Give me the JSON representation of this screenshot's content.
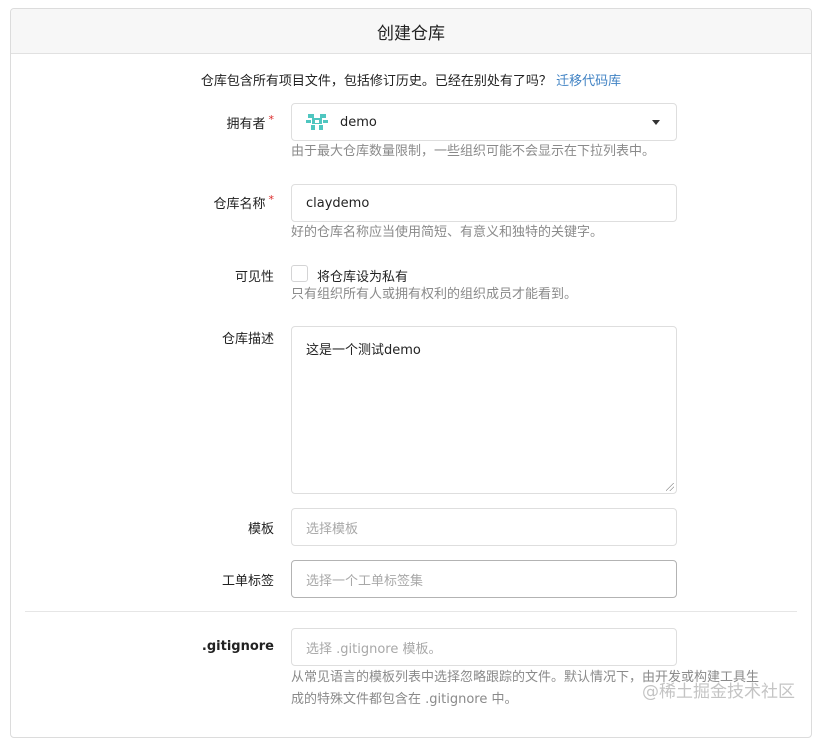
{
  "header": {
    "title": "创建仓库"
  },
  "intro": {
    "text": "仓库包含所有项目文件，包括修订历史。已经在别处有了吗？",
    "link": "迁移代码库"
  },
  "owner": {
    "label": "拥有者",
    "required_mark": "*",
    "value": "demo",
    "help": "由于最大仓库数量限制，一些组织可能不会显示在下拉列表中。"
  },
  "repo_name": {
    "label": "仓库名称",
    "required_mark": "*",
    "value": "claydemo",
    "help": "好的仓库名称应当使用简短、有意义和独特的关键字。"
  },
  "visibility": {
    "label": "可见性",
    "checkbox_label": "将仓库设为私有",
    "help": "只有组织所有人或拥有权利的组织成员才能看到。"
  },
  "description": {
    "label": "仓库描述",
    "value": "这是一个测试demo"
  },
  "template": {
    "label": "模板",
    "placeholder": "选择模板"
  },
  "issue_labels": {
    "label": "工单标签",
    "placeholder": "选择一个工单标签集"
  },
  "gitignore": {
    "label": ".gitignore",
    "placeholder": "选择 .gitignore 模板。",
    "help_line1": "从常见语言的模板列表中选择忽略跟踪的文件。默认情况下，由开发或构建工具生",
    "help_line2": "成的特殊文件都包含在 .gitignore 中。"
  },
  "watermark": "@稀土掘金技术社区",
  "colors": {
    "link": "#4183c4",
    "required": "#db2828",
    "avatar": "#4fc6c0"
  }
}
